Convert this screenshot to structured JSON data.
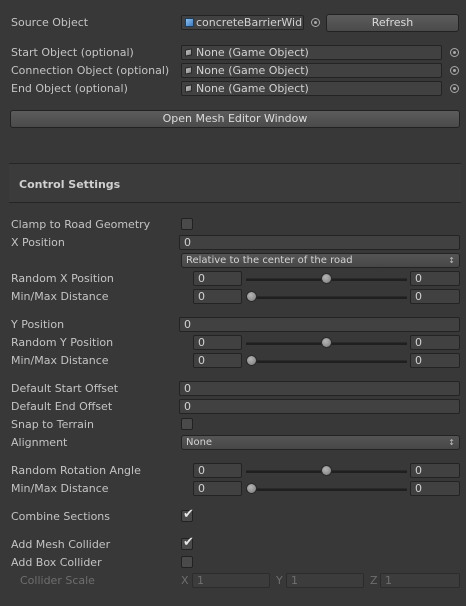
{
  "source": {
    "label": "Source Object",
    "value": "concreteBarrierWid",
    "refresh_label": "Refresh"
  },
  "objects": [
    {
      "label": "Start Object (optional)",
      "value": "None (Game Object)"
    },
    {
      "label": "Connection Object (optional)",
      "value": "None (Game Object)"
    },
    {
      "label": "End Object (optional)",
      "value": "None (Game Object)"
    }
  ],
  "open_mesh_editor_label": "Open Mesh Editor Window",
  "control_settings": {
    "title": "Control Settings",
    "clamp_label": "Clamp to Road Geometry",
    "clamp_checked": false,
    "x_position": {
      "label": "X Position",
      "value": "0"
    },
    "x_mode": "Relative to the center of the road",
    "random_x": {
      "label": "Random X Position",
      "min": "0",
      "max": "0",
      "slider": 0.5
    },
    "random_x_range": {
      "label": "Min/Max Distance",
      "min": "0",
      "max": "0",
      "slider": 0.0
    },
    "y_position": {
      "label": "Y Position",
      "value": "0"
    },
    "random_y": {
      "label": "Random Y Position",
      "min": "0",
      "max": "0",
      "slider": 0.5
    },
    "random_y_range": {
      "label": "Min/Max Distance",
      "min": "0",
      "max": "0",
      "slider": 0.0
    },
    "default_start_offset": {
      "label": "Default Start Offset",
      "value": "0"
    },
    "default_end_offset": {
      "label": "Default End Offset",
      "value": "0"
    },
    "snap_label": "Snap to Terrain",
    "snap_checked": false,
    "alignment": {
      "label": "Alignment",
      "value": "None"
    },
    "random_rotation": {
      "label": "Random Rotation Angle",
      "min": "0",
      "max": "0",
      "slider": 0.5
    },
    "random_rotation_range": {
      "label": "Min/Max Distance",
      "min": "0",
      "max": "0",
      "slider": 0.0
    },
    "combine_label": "Combine Sections",
    "combine_checked": true,
    "mesh_collider_label": "Add Mesh Collider",
    "mesh_collider_checked": true,
    "box_collider_label": "Add Box Collider",
    "box_collider_checked": false,
    "collider_scale": {
      "label": "Collider Scale",
      "x_label": "X",
      "x": "1",
      "y_label": "Y",
      "y": "1",
      "z_label": "Z",
      "z": "1"
    }
  }
}
